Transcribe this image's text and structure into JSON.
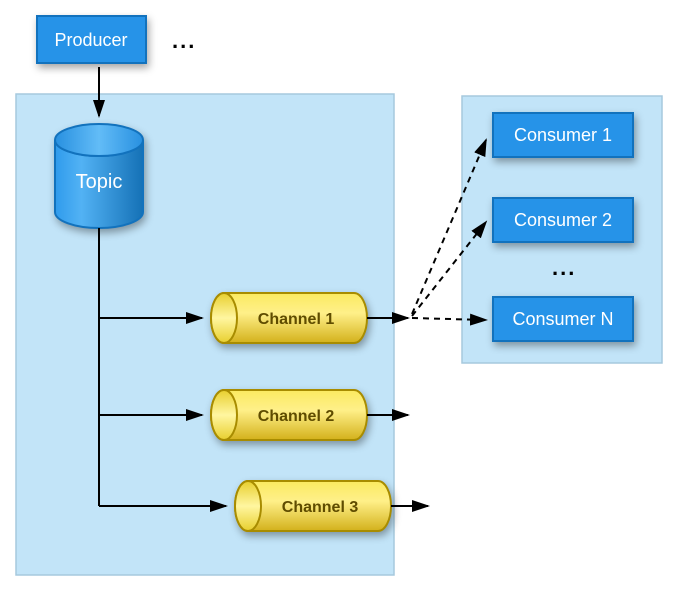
{
  "producer": {
    "label": "Producer"
  },
  "producer_ellipsis": "...",
  "topic": {
    "label": "Topic"
  },
  "channels": [
    {
      "label": "Channel 1"
    },
    {
      "label": "Channel 2"
    },
    {
      "label": "Channel 3"
    }
  ],
  "consumers": [
    {
      "label": "Consumer 1"
    },
    {
      "label": "Consumer 2"
    },
    {
      "label": "Consumer N"
    }
  ],
  "consumer_ellipsis": "...",
  "colors": {
    "blue": "#2693E8",
    "blue_stroke": "#1272BD",
    "panel": "#C2E4F8",
    "yellow": "#F7E143",
    "yellow_stroke": "#A88C00"
  }
}
